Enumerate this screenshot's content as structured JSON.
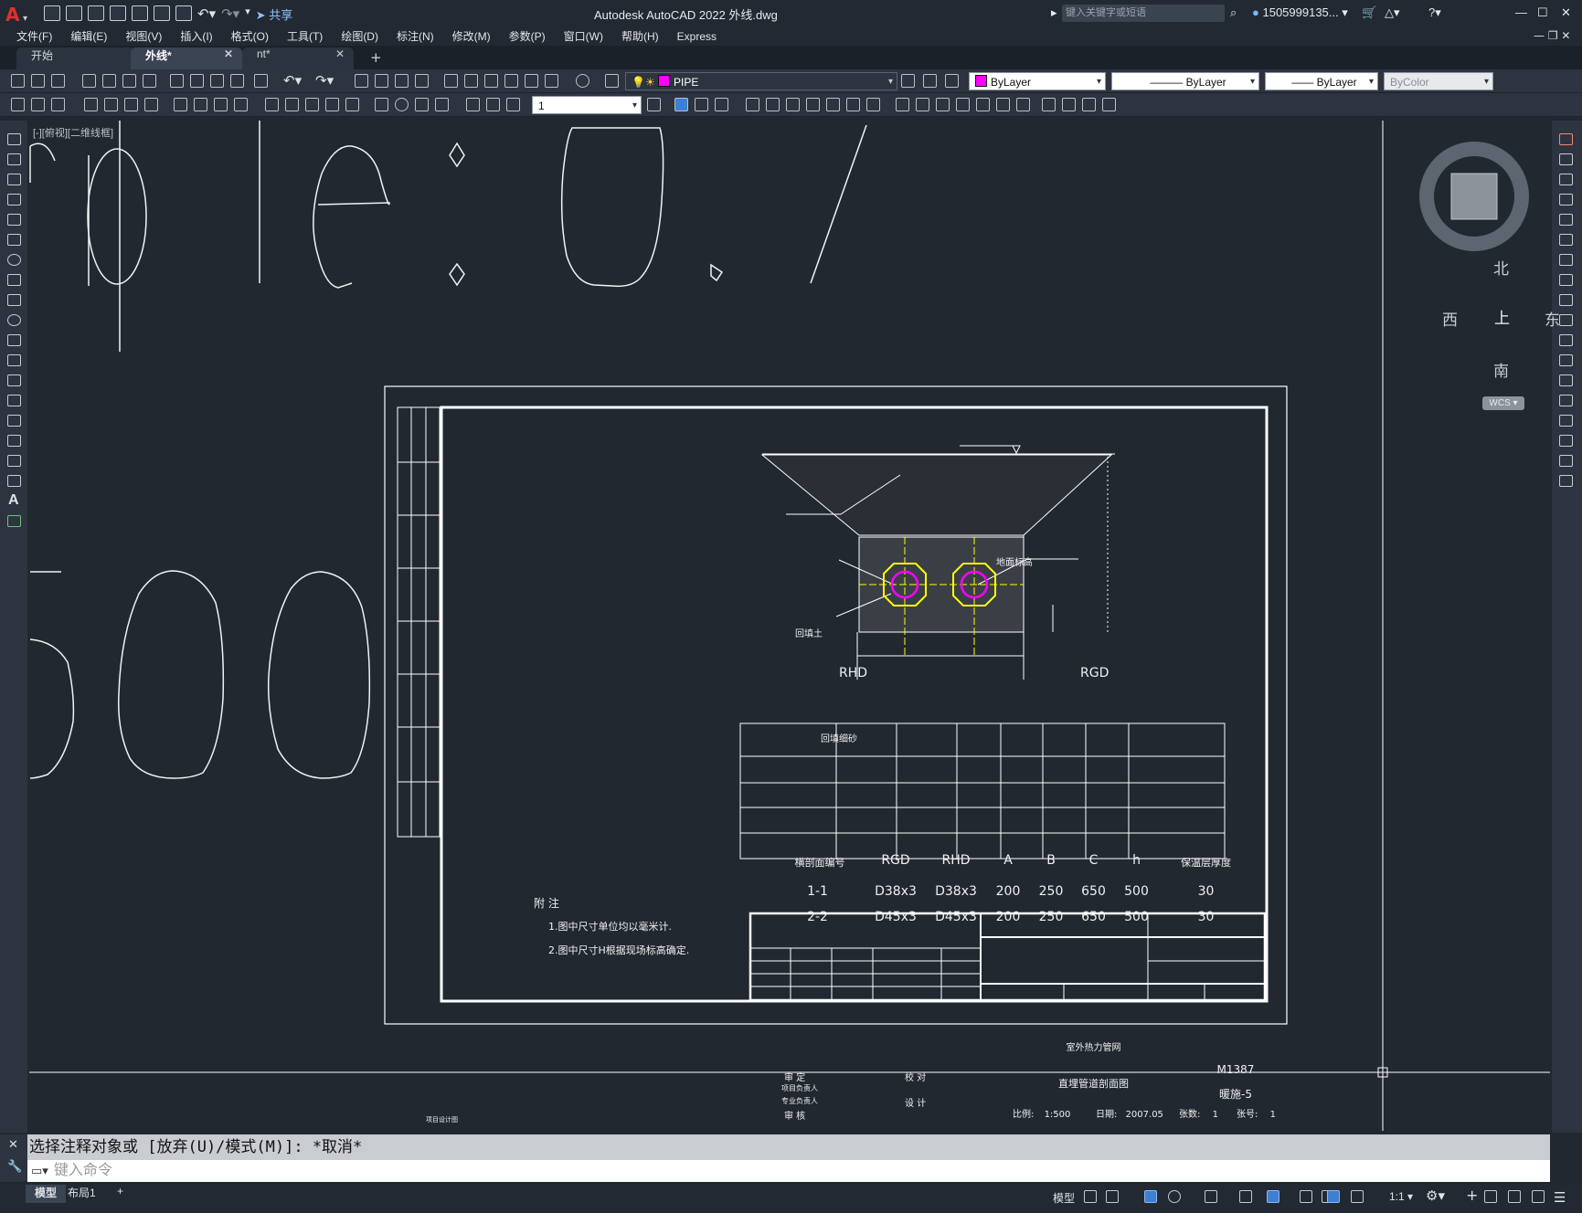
{
  "titlebar": {
    "app_logo": "A",
    "title": "Autodesk AutoCAD 2022    外线.dwg",
    "share": "共享",
    "search_placeholder": "键入关键字或短语",
    "user": "1505999135...",
    "window_controls": [
      "minimize",
      "maximize",
      "close"
    ]
  },
  "menu": [
    "文件(F)",
    "编辑(E)",
    "视图(V)",
    "插入(I)",
    "格式(O)",
    "工具(T)",
    "绘图(D)",
    "标注(N)",
    "修改(M)",
    "参数(P)",
    "窗口(W)",
    "帮助(H)",
    "Express"
  ],
  "tabs": [
    {
      "label": "开始",
      "closable": false
    },
    {
      "label": "外线*",
      "closable": true,
      "active": true
    },
    {
      "label": "nt*",
      "closable": true
    }
  ],
  "properties": {
    "layer": "PIPE",
    "layer_color": "#ff00ff",
    "color": "ByLayer",
    "color_swatch": "#ff00ff",
    "linetype": "ByLayer",
    "lineweight": "ByLayer",
    "plotstyle": "ByColor",
    "dim_scale": "1"
  },
  "viewport_label": "[-][俯视][二维线框]",
  "large_text": {
    "row1": "rple: 0. /",
    "row2": "500"
  },
  "drawing": {
    "ground_label": "地面标高",
    "backfill_label": "回填土",
    "sand_label": "回填细砂",
    "pipe_left": "RHD",
    "pipe_right": "RGD",
    "notes_title": "附 注",
    "notes": [
      "1.图中尺寸单位均以毫米计.",
      "2.图中尺寸H根据现场标高确定."
    ],
    "side_label": "项目设计图",
    "table": {
      "headers": [
        "横剖面编号",
        "RGD",
        "RHD",
        "A",
        "B",
        "C",
        "h",
        "保温层厚度"
      ],
      "rows": [
        [
          "1-1",
          "D38x3",
          "D38x3",
          "200",
          "250",
          "650",
          "500",
          "30"
        ],
        [
          "2-2",
          "D45x3",
          "D45x3",
          "200",
          "250",
          "650",
          "500",
          "30"
        ],
        [
          "",
          "",
          "",
          "",
          "",
          "",
          "",
          ""
        ],
        [
          "",
          "",
          "",
          "",
          "",
          "",
          "",
          ""
        ]
      ]
    },
    "title_block": {
      "project": "室外热力管网",
      "drawing_name": "直埋管道剖面图",
      "code": "M1387",
      "sheet": "暖施-5",
      "scale_label": "比例:",
      "scale": "1:500",
      "date_label": "日期:",
      "date": "2007.05",
      "count_label": "张数:",
      "count": "1",
      "number_label": "张号:",
      "number": "1",
      "review": "审  定",
      "check": "校  对",
      "pm": "项目负责人",
      "pro": "专业负责人",
      "design": "设  计",
      "audit": "审  核"
    }
  },
  "viewcube": {
    "north": "北",
    "south": "南",
    "east": "东",
    "west": "西",
    "face": "上",
    "ucs": "WCS"
  },
  "command": {
    "history": "选择注释对象或 [放弃(U)/模式(M)]: *取消*",
    "placeholder": "键入命令"
  },
  "layout_tabs": [
    "模型",
    "布局1",
    "+"
  ],
  "status": {
    "model": "模型",
    "scale": "1:1"
  }
}
